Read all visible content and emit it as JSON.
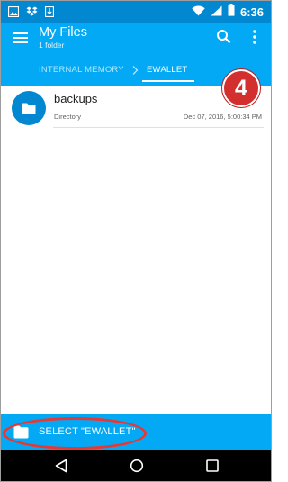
{
  "status_bar": {
    "time": "6:36",
    "left_icons": [
      "image-icon",
      "dropbox-icon",
      "download-icon"
    ],
    "right_icons": [
      "wifi-icon",
      "signal-icon",
      "battery-icon"
    ]
  },
  "app_bar": {
    "title": "My Files",
    "subtitle": "1 folder",
    "actions": [
      "search-icon",
      "more-vert-icon"
    ]
  },
  "breadcrumb": {
    "items": [
      "INTERNAL MEMORY",
      "EWALLET"
    ],
    "active_index": 1
  },
  "files": [
    {
      "name": "backups",
      "type": "Directory",
      "date": "Dec 07, 2016, 5:00:34 PM",
      "icon": "folder-icon"
    }
  ],
  "annotation": {
    "step": "4"
  },
  "select_bar": {
    "label": "SELECT \"EWALLET\"",
    "icon": "folder-icon"
  },
  "colors": {
    "status_bar": "#0288d1",
    "app_bar": "#03a9f4",
    "folder_circle": "#0288d1",
    "badge": "#d32f2f",
    "highlight": "#e53935"
  }
}
